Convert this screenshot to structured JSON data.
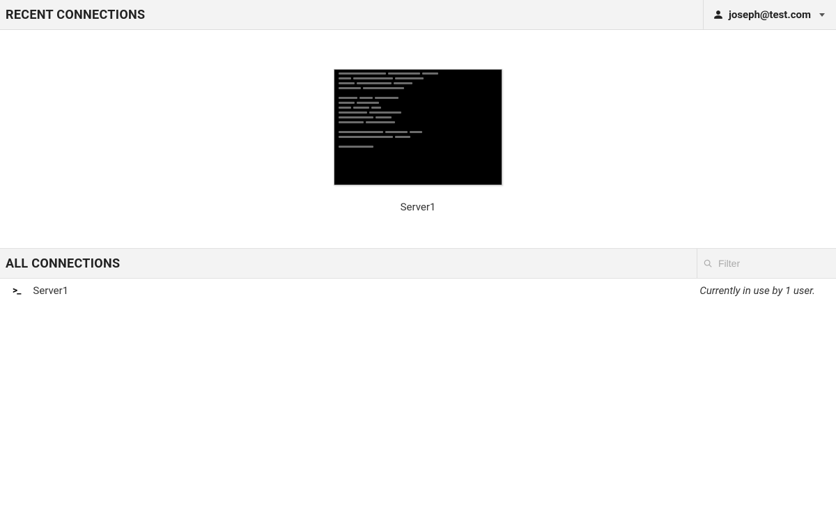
{
  "header": {
    "title": "RECENT CONNECTIONS",
    "user_email": "joseph@test.com"
  },
  "recent": {
    "items": [
      {
        "name": "Server1"
      }
    ]
  },
  "all_section": {
    "title": "ALL CONNECTIONS",
    "filter_placeholder": "Filter"
  },
  "connections": [
    {
      "name": "Server1",
      "status": "Currently in use by 1 user."
    }
  ]
}
